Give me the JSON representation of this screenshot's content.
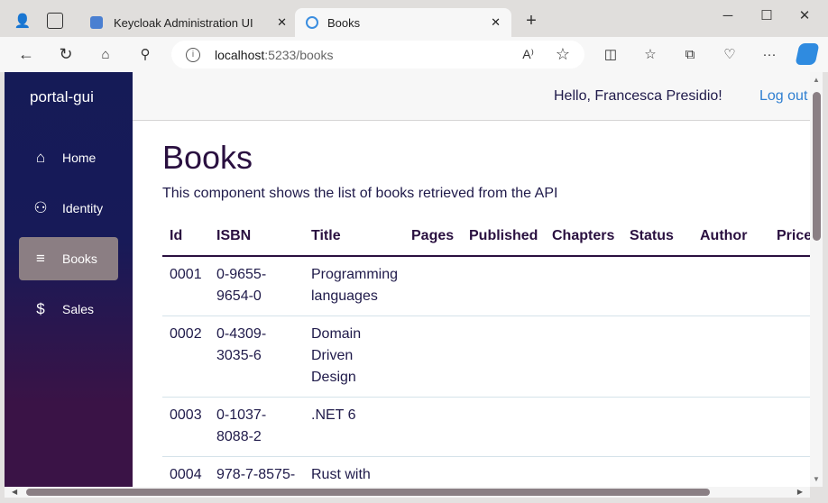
{
  "browser": {
    "tabs": [
      {
        "label": "Keycloak Administration UI",
        "icon": "keycloak-icon"
      },
      {
        "label": "Books",
        "icon": "blazor-icon",
        "active": true
      }
    ],
    "address": {
      "host": "localhost",
      "rest": ":5233/books"
    },
    "icons": [
      "profile-icon",
      "tab-actions-icon",
      "back-icon",
      "refresh-icon",
      "home-icon",
      "search-icon",
      "info-icon",
      "read-aloud-icon",
      "favorite-icon",
      "split-screen-icon",
      "favorites-icon",
      "collections-icon",
      "browser-essentials-icon",
      "more-icon",
      "copilot-icon",
      "minimize-icon",
      "maximize-icon",
      "close-icon"
    ]
  },
  "sidebar": {
    "brand": "portal-gui",
    "items": [
      {
        "label": "Home",
        "icon": "home-icon"
      },
      {
        "label": "Identity",
        "icon": "person-icon"
      },
      {
        "label": "Books",
        "icon": "list-icon",
        "active": true
      },
      {
        "label": "Sales",
        "icon": "dollar-icon"
      }
    ]
  },
  "header": {
    "greeting": "Hello, Francesca Presidio!",
    "logout": "Log out"
  },
  "main": {
    "title": "Books",
    "description": "This component shows the list of books retrieved from the API",
    "columns": [
      "Id",
      "ISBN",
      "Title",
      "Pages",
      "Published",
      "Chapters",
      "Status",
      "Author",
      "Price"
    ],
    "rows": [
      {
        "id": "0001",
        "isbn": "0-9655-9654-0",
        "title": "Programming languages"
      },
      {
        "id": "0002",
        "isbn": "0-4309-3035-6",
        "title": "Domain Driven Design"
      },
      {
        "id": "0003",
        "isbn": "0-1037-8088-2",
        "title": ".NET 6"
      },
      {
        "id": "0004",
        "isbn": "978-7-8575-",
        "title": "Rust with"
      }
    ]
  },
  "colors": {
    "sidebar_top": "#151b57",
    "sidebar_bottom": "#3a1346",
    "active_item": "#8b7e83",
    "link": "#2f7fd1"
  }
}
